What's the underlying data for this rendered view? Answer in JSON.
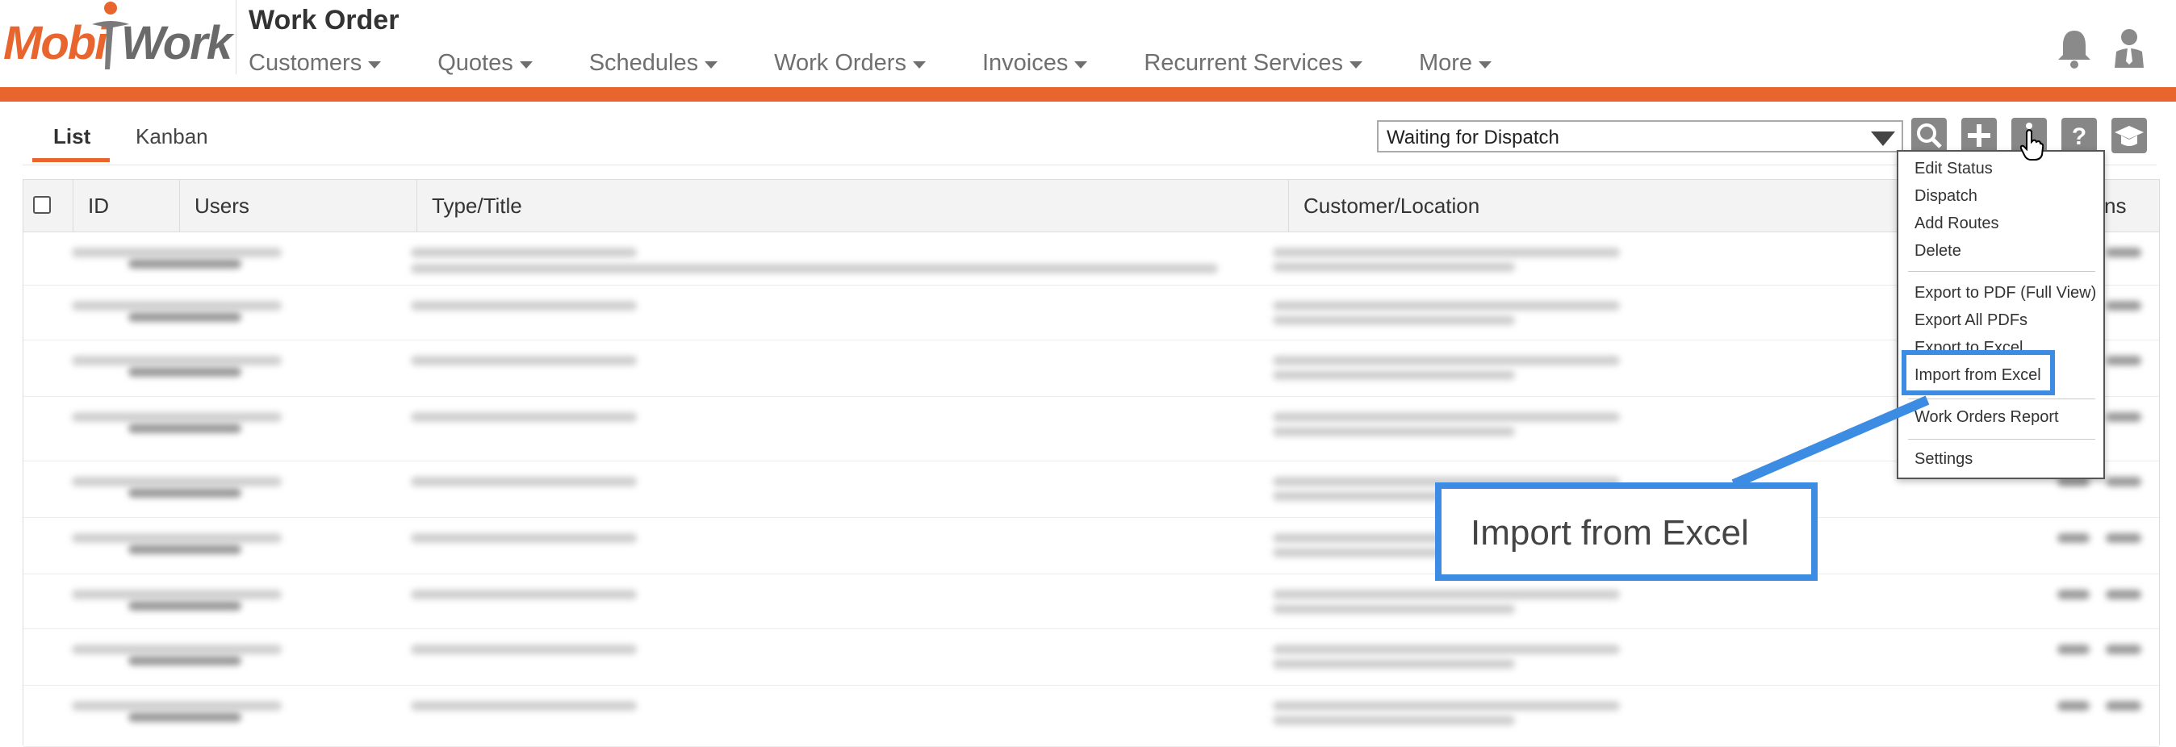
{
  "app": {
    "logo_left": "Mobi",
    "logo_right": "Work",
    "title": "Work Order"
  },
  "nav": {
    "items": [
      {
        "label": "Customers"
      },
      {
        "label": "Quotes"
      },
      {
        "label": "Schedules"
      },
      {
        "label": "Work Orders"
      },
      {
        "label": "Invoices"
      },
      {
        "label": "Recurrent Services"
      },
      {
        "label": "More"
      }
    ]
  },
  "header_icons": [
    "bell-icon",
    "user-icon"
  ],
  "tabs": [
    {
      "label": "List",
      "active": true
    },
    {
      "label": "Kanban",
      "active": false
    }
  ],
  "status_filter": {
    "value": "Waiting for Dispatch"
  },
  "toolbar_icons": [
    "search-icon",
    "plus-icon",
    "more-vertical-icon",
    "help-icon",
    "graduation-cap-icon"
  ],
  "table": {
    "columns": [
      "ID",
      "Users",
      "Type/Title",
      "Customer/Location",
      "ns"
    ]
  },
  "menu": {
    "items": [
      {
        "label": "Edit Status"
      },
      {
        "label": "Dispatch"
      },
      {
        "label": "Add Routes"
      },
      {
        "label": "Delete"
      },
      {
        "label": "Export to PDF (Full View)"
      },
      {
        "label": "Export All PDFs"
      },
      {
        "label": "Export to Excel"
      },
      {
        "label": "Import from Excel"
      },
      {
        "label": "Work Orders Report"
      },
      {
        "label": "Settings"
      }
    ]
  },
  "callout": {
    "label": "Import from Excel"
  },
  "colors": {
    "brand_orange": "#e8652d",
    "highlight_blue": "#3d8ce3",
    "icon_gray": "#878787"
  }
}
